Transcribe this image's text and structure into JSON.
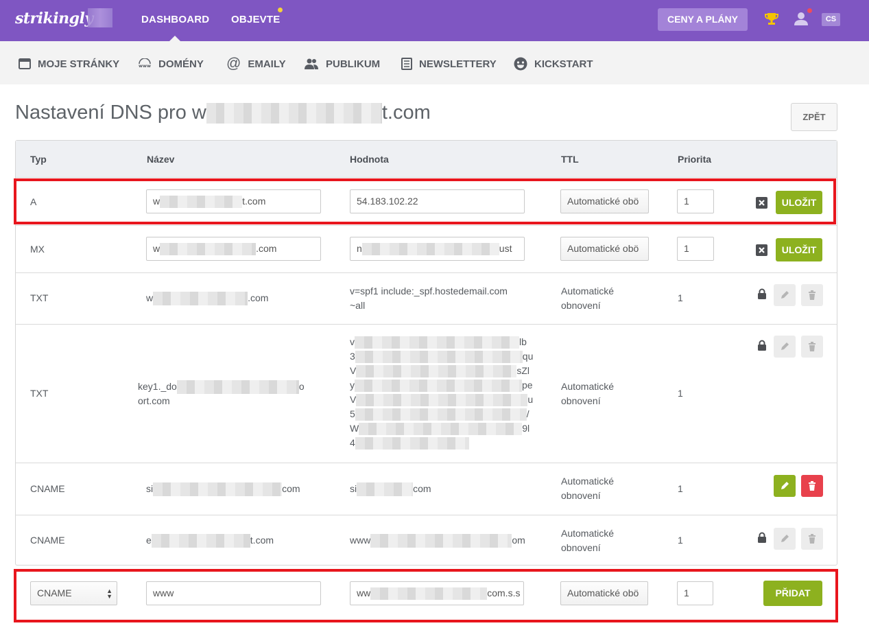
{
  "topbar": {
    "logo": "strikingly",
    "nav": [
      "DASHBOARD",
      "OBJEVTE"
    ],
    "plans_button": "CENY A PLÁNY",
    "lang": "CS"
  },
  "subnav": [
    "MOJE STRÁNKY",
    "DOMÉNY",
    "EMAILY",
    "PUBLIKUM",
    "NEWSLETTERY",
    "KICKSTART"
  ],
  "page": {
    "title_prefix": "Nastavení DNS pro w",
    "title_suffix": "t.com",
    "back_button": "ZPĚT"
  },
  "table": {
    "headers": [
      "Typ",
      "Název",
      "Hodnota",
      "TTL",
      "Priorita"
    ],
    "rows": [
      {
        "type": "A",
        "name": "w",
        "name_suffix": "t.com",
        "value": "54.183.102.22",
        "ttl": "Automatické obö",
        "priority": "1",
        "action": "ULOŽIT"
      },
      {
        "type": "MX",
        "name": "w",
        "name_suffix": ".com",
        "value": "n",
        "value_suffix": "ust",
        "ttl": "Automatické obö",
        "priority": "1",
        "action": "ULOŽIT"
      },
      {
        "type": "TXT",
        "name": "w",
        "name_suffix": ".com",
        "value_line1": "v=spf1 include:_spf.hostedemail.com",
        "value_line2": "~all",
        "ttl_line1": "Automatické",
        "ttl_line2": "obnovení",
        "priority": "1"
      },
      {
        "type": "TXT",
        "name_line1": "key1._do",
        "name_line1_end": "o",
        "name_line2": "ort.com",
        "value_starts": [
          "v",
          "3",
          "V",
          "y",
          "V",
          "5",
          "W",
          "4"
        ],
        "value_ends": [
          "lb",
          "qu",
          "sZl",
          "pe",
          "u",
          "/",
          "9l",
          ""
        ],
        "ttl_line1": "Automatické",
        "ttl_line2": "obnovení",
        "priority": "1"
      },
      {
        "type": "CNAME",
        "name": "si",
        "name_suffix": "com",
        "value": "si",
        "value_suffix": "com",
        "ttl_line1": "Automatické",
        "ttl_line2": "obnovení",
        "priority": "1"
      },
      {
        "type": "CNAME",
        "name": "e",
        "name_suffix": "t.com",
        "value": "www",
        "value_suffix": "om",
        "ttl_line1": "Automatické",
        "ttl_line2": "obnovení",
        "priority": "1"
      }
    ],
    "new_row": {
      "type": "CNAME",
      "name": "www",
      "value": "ww",
      "value_suffix": "com.s.s",
      "ttl": "Automatické obö",
      "priority": "1",
      "action": "PŘIDAT"
    }
  },
  "colors": {
    "brand": "#7f56c2",
    "green": "#8db11f",
    "red": "#e8414c",
    "highlight": "#e8161d"
  }
}
